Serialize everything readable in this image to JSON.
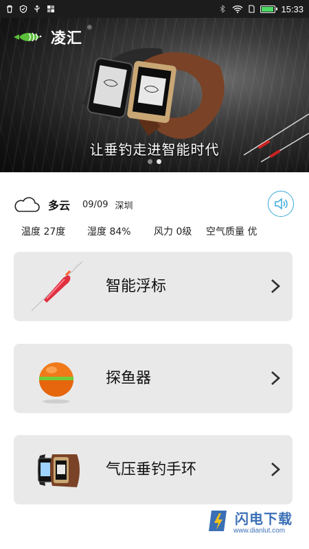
{
  "status_bar": {
    "time": "15:33",
    "icons_left": [
      "trash-icon",
      "shield-icon",
      "usb-icon",
      "apps-icon"
    ],
    "icons_right": [
      "bluetooth-icon",
      "wifi-icon",
      "sim-icon",
      "battery-icon"
    ],
    "battery_level": 1.0,
    "battery_color": "#4cd964"
  },
  "banner": {
    "brand": "凌汇",
    "brand_mark": "®",
    "slogan": "让垂钓走进智能时代",
    "slide_count": 2,
    "active_slide": 1
  },
  "weather": {
    "condition": "多云",
    "date": "09/09",
    "city": "深圳",
    "temperature": "温度 27度",
    "humidity": "湿度 84%",
    "wind": "风力 0级",
    "air_quality": "空气质量 优",
    "accent_color": "#3aa8d8"
  },
  "menu": [
    {
      "label": "智能浮标",
      "icon": "smart-float-icon"
    },
    {
      "label": "探鱼器",
      "icon": "fish-finder-icon"
    },
    {
      "label": "气压垂钓手环",
      "icon": "smart-band-icon"
    }
  ],
  "watermark": {
    "title": "闪电下载",
    "url": "www.dianlut.com",
    "color": "#3b6fb6"
  }
}
